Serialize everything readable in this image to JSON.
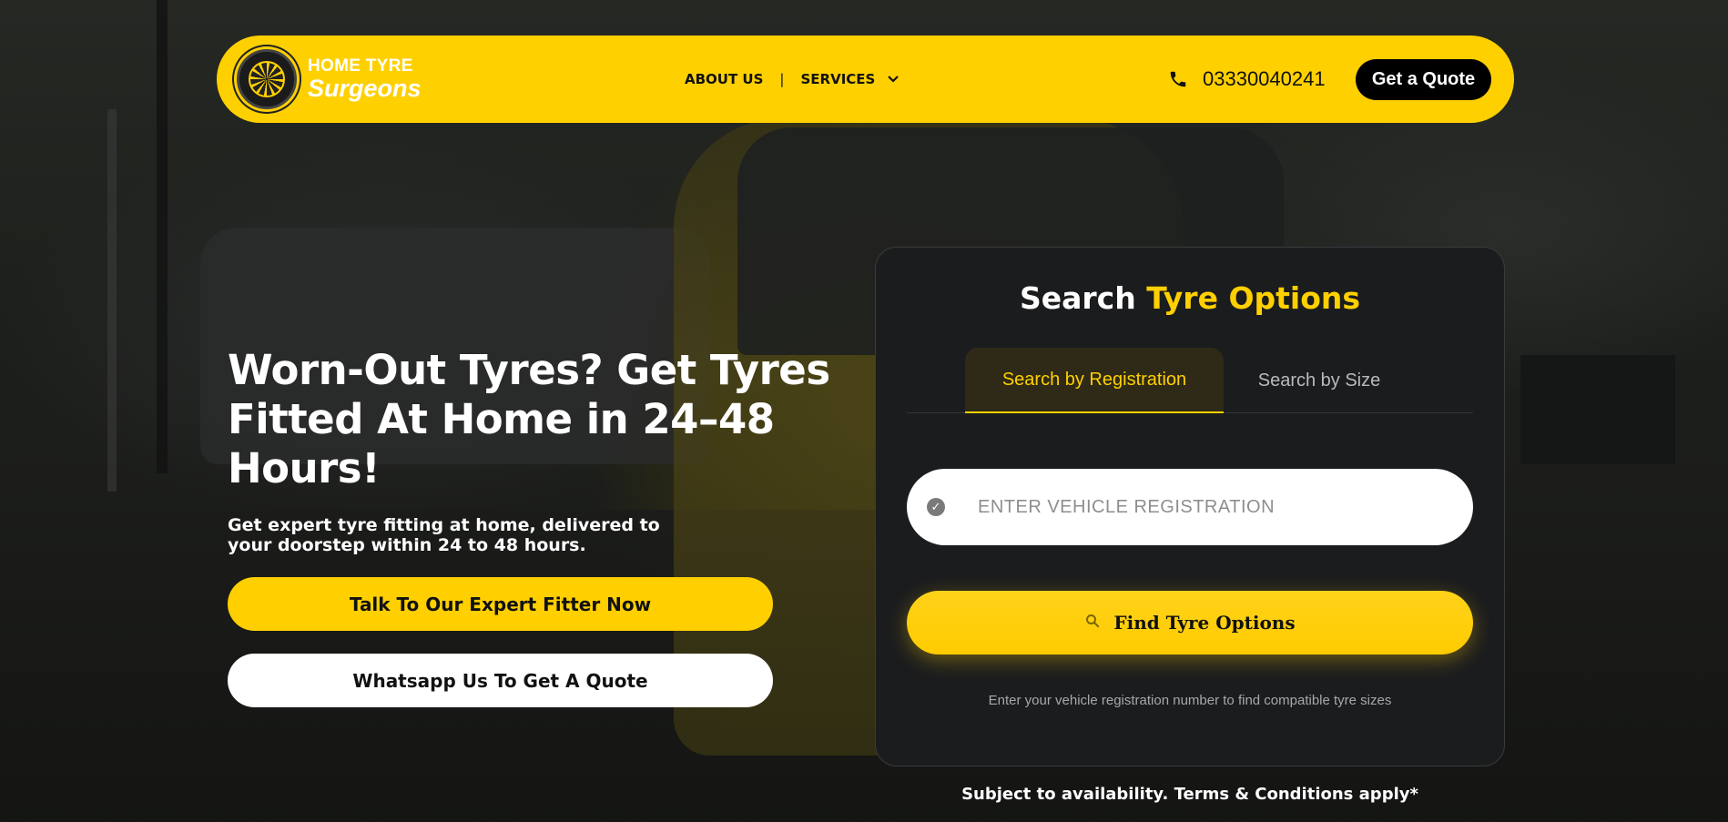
{
  "brand": {
    "line1": "HOME TYRE",
    "line2": "Surgeons",
    "accent_color": "#ffd000"
  },
  "nav": {
    "items": [
      {
        "label": "ABOUT US"
      },
      {
        "label": "SERVICES"
      }
    ],
    "separator": "|",
    "services_icon": "chevron-down-icon"
  },
  "contact": {
    "phone_icon": "phone-icon",
    "phone": "03330040241",
    "quote_label": "Get a Quote"
  },
  "hero": {
    "title": "Worn-Out Tyres? Get Tyres Fitted At Home in 24–48 Hours!",
    "subtitle": "Get expert tyre fitting at home, delivered to your doorstep within 24 to 48 hours.",
    "expert_button": "Talk To Our Expert Fitter Now",
    "whatsapp_button": "Whatsapp Us To Get A Quote"
  },
  "search": {
    "title_white": "Search",
    "title_yellow": "Tyre Options",
    "tabs": [
      {
        "label": "Search by Registration",
        "active": true
      },
      {
        "label": "Search by Size",
        "active": false
      }
    ],
    "registration_placeholder": "ENTER VEHICLE REGISTRATION",
    "registration_value": "",
    "find_button": "Find Tyre Options",
    "find_icon": "search-icon",
    "note": "Enter your vehicle registration number to find compatible tyre sizes"
  },
  "terms": "Subject to availability. Terms & Conditions apply*"
}
